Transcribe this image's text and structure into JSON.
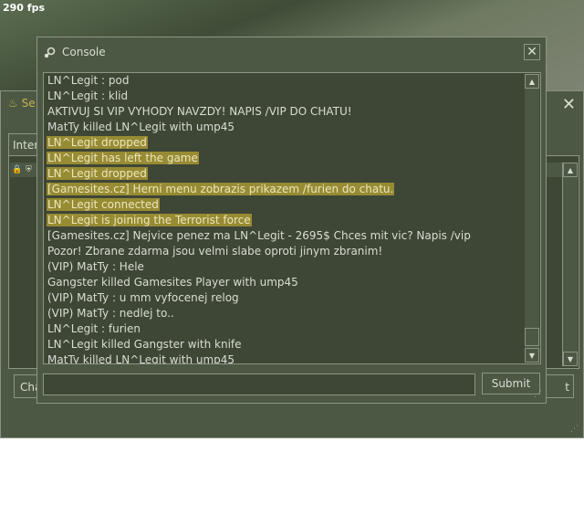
{
  "hud": {
    "fps": "290 fps"
  },
  "background_window": {
    "title_fragment": "Se",
    "tab_label": "Inter",
    "chat_button_label": "Cha",
    "right_button_label": "t"
  },
  "console": {
    "title": "Console",
    "submit_label": "Submit",
    "input_value": "",
    "lines": [
      {
        "text": "LN^Legit :  pod",
        "highlight": false
      },
      {
        "text": "LN^Legit :  klid",
        "highlight": false
      },
      {
        "text": "AKTIVUJ SI VIP VYHODY NAVZDY! NAPIS /VIP DO CHATU!",
        "highlight": false
      },
      {
        "text": "MatTy killed LN^Legit with ump45",
        "highlight": false
      },
      {
        "text": "LN^Legit dropped",
        "highlight": true
      },
      {
        "text": "LN^Legit has left the game",
        "highlight": true
      },
      {
        "text": "LN^Legit dropped",
        "highlight": true
      },
      {
        "text": "[Gamesites.cz] Herni menu zobrazis prikazem /furien do chatu.",
        "highlight": true
      },
      {
        "text": "LN^Legit connected",
        "highlight": true
      },
      {
        "text": "LN^Legit is joining the Terrorist force",
        "highlight": true
      },
      {
        "text": "[Gamesites.cz] Nejvice penez ma LN^Legit - 2695$ Chces mit vic? Napis /vip",
        "highlight": false
      },
      {
        "text": "Pozor! Zbrane zdarma jsou velmi slabe oproti jinym zbranim!",
        "highlight": false
      },
      {
        "text": "(VIP) MatTy :  Hele",
        "highlight": false
      },
      {
        "text": "Gangster killed Gamesites Player with ump45",
        "highlight": false
      },
      {
        "text": "(VIP) MatTy :  u mm vyfocenej relog",
        "highlight": false
      },
      {
        "text": "(VIP) MatTy :  nedlej to..",
        "highlight": false
      },
      {
        "text": "LN^Legit :  furien",
        "highlight": false
      },
      {
        "text": "LN^Legit killed Gangster with knife",
        "highlight": false
      },
      {
        "text": "MatTy killed LN^Legit with ump45",
        "highlight": false
      }
    ]
  }
}
